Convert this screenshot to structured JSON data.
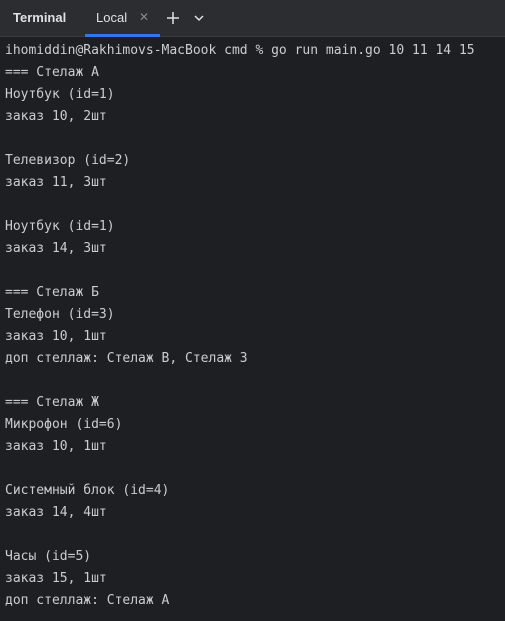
{
  "toolwindow": {
    "title": "Terminal"
  },
  "tabs": [
    {
      "label": "Local",
      "active": true,
      "close_icon": "close-icon"
    }
  ],
  "toolbar": {
    "new_tab_icon": "plus-icon",
    "tab_menu_icon": "chevron-down-icon"
  },
  "colors": {
    "tab_accent": "#3574f0",
    "background": "#1e1f22",
    "header_background": "#2b2d30",
    "text": "#cbcdd1"
  },
  "terminal": {
    "lines": [
      "ihomiddin@Rakhimovs-MacBook cmd % go run main.go 10 11 14 15",
      "=== Стелаж А",
      "Ноутбук (id=1)",
      "заказ 10, 2шт",
      "",
      "Телевизор (id=2)",
      "заказ 11, 3шт",
      "",
      "Ноутбук (id=1)",
      "заказ 14, 3шт",
      "",
      "=== Стелаж Б",
      "Телефон (id=3)",
      "заказ 10, 1шт",
      "доп стеллаж: Стелаж В, Стелаж З",
      "",
      "=== Стелаж Ж",
      "Микрофон (id=6)",
      "заказ 10, 1шт",
      "",
      "Системный блок (id=4)",
      "заказ 14, 4шт",
      "",
      "Часы (id=5)",
      "заказ 15, 1шт",
      "доп стеллаж: Стелаж А"
    ]
  }
}
